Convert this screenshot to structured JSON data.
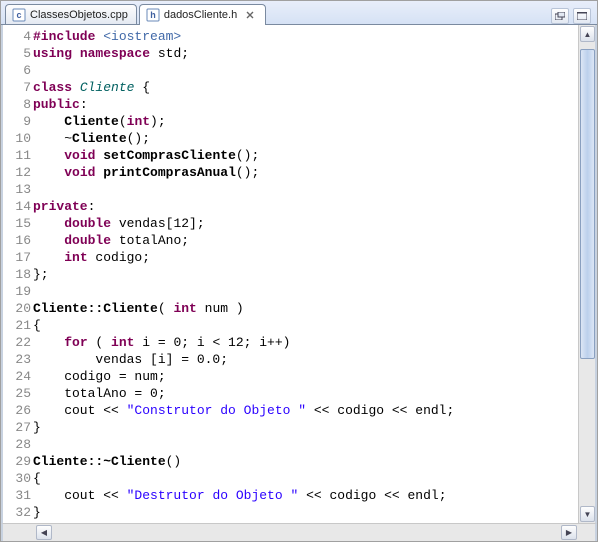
{
  "tabs": [
    {
      "icon": "c-file",
      "label": "ClassesObjetos.cpp",
      "active": false
    },
    {
      "icon": "h-file",
      "label": "dadosCliente.h",
      "active": true
    }
  ],
  "toolbar": {
    "maximize_title": "Maximize",
    "restore_title": "Restore"
  },
  "code_lines": [
    {
      "n": 4,
      "tokens": [
        [
          "pp",
          "#include "
        ],
        [
          "inc",
          "<iostream>"
        ]
      ]
    },
    {
      "n": 5,
      "tokens": [
        [
          "kw",
          "using"
        ],
        [
          "",
          " "
        ],
        [
          "kw",
          "namespace"
        ],
        [
          "",
          " std;"
        ]
      ]
    },
    {
      "n": 6,
      "tokens": []
    },
    {
      "n": 7,
      "tokens": [
        [
          "kw",
          "class"
        ],
        [
          "",
          " "
        ],
        [
          "typ",
          "Cliente"
        ],
        [
          "",
          " {"
        ]
      ]
    },
    {
      "n": 8,
      "tokens": [
        [
          "kw",
          "public"
        ],
        [
          "",
          ":"
        ]
      ]
    },
    {
      "n": 9,
      "tokens": [
        [
          "",
          "    "
        ],
        [
          "mtd",
          "Cliente"
        ],
        [
          "",
          "("
        ],
        [
          "kw",
          "int"
        ],
        [
          "",
          ");"
        ]
      ]
    },
    {
      "n": 10,
      "tokens": [
        [
          "",
          "    ~"
        ],
        [
          "mtd",
          "Cliente"
        ],
        [
          "",
          "();"
        ]
      ]
    },
    {
      "n": 11,
      "tokens": [
        [
          "",
          "    "
        ],
        [
          "kw",
          "void"
        ],
        [
          "",
          " "
        ],
        [
          "mtd",
          "setComprasCliente"
        ],
        [
          "",
          "();"
        ]
      ]
    },
    {
      "n": 12,
      "tokens": [
        [
          "",
          "    "
        ],
        [
          "kw",
          "void"
        ],
        [
          "",
          " "
        ],
        [
          "mtd",
          "printComprasAnual"
        ],
        [
          "",
          "();"
        ]
      ]
    },
    {
      "n": 13,
      "tokens": []
    },
    {
      "n": 14,
      "tokens": [
        [
          "kw",
          "private"
        ],
        [
          "",
          ":"
        ]
      ]
    },
    {
      "n": 15,
      "tokens": [
        [
          "",
          "    "
        ],
        [
          "kw",
          "double"
        ],
        [
          "",
          " vendas[12];"
        ]
      ]
    },
    {
      "n": 16,
      "tokens": [
        [
          "",
          "    "
        ],
        [
          "kw",
          "double"
        ],
        [
          "",
          " totalAno;"
        ]
      ]
    },
    {
      "n": 17,
      "tokens": [
        [
          "",
          "    "
        ],
        [
          "kw",
          "int"
        ],
        [
          "",
          " codigo;"
        ]
      ]
    },
    {
      "n": 18,
      "tokens": [
        [
          "",
          "};"
        ]
      ]
    },
    {
      "n": 19,
      "tokens": []
    },
    {
      "n": 20,
      "tokens": [
        [
          "mtd",
          "Cliente::Cliente"
        ],
        [
          "",
          "( "
        ],
        [
          "kw",
          "int"
        ],
        [
          "",
          " num )"
        ]
      ]
    },
    {
      "n": 21,
      "tokens": [
        [
          "",
          "{"
        ]
      ]
    },
    {
      "n": 22,
      "tokens": [
        [
          "",
          "    "
        ],
        [
          "kw",
          "for"
        ],
        [
          "",
          " ( "
        ],
        [
          "kw",
          "int"
        ],
        [
          "",
          " i = 0; i < 12; i++)"
        ]
      ]
    },
    {
      "n": 23,
      "tokens": [
        [
          "",
          "        vendas [i] = 0.0;"
        ]
      ]
    },
    {
      "n": 24,
      "tokens": [
        [
          "",
          "    codigo = num;"
        ]
      ]
    },
    {
      "n": 25,
      "tokens": [
        [
          "",
          "    totalAno = 0;"
        ]
      ]
    },
    {
      "n": 26,
      "tokens": [
        [
          "",
          "    cout << "
        ],
        [
          "str",
          "\"Construtor do Objeto \""
        ],
        [
          "",
          " << codigo << endl;"
        ]
      ]
    },
    {
      "n": 27,
      "tokens": [
        [
          "",
          "}"
        ]
      ]
    },
    {
      "n": 28,
      "tokens": []
    },
    {
      "n": 29,
      "tokens": [
        [
          "mtd",
          "Cliente::~Cliente"
        ],
        [
          "",
          "()"
        ]
      ]
    },
    {
      "n": 30,
      "tokens": [
        [
          "",
          "{"
        ]
      ]
    },
    {
      "n": 31,
      "tokens": [
        [
          "",
          "    cout << "
        ],
        [
          "str",
          "\"Destrutor do Objeto \""
        ],
        [
          "",
          " << codigo << endl;"
        ]
      ]
    },
    {
      "n": 32,
      "tokens": [
        [
          "",
          "}"
        ]
      ]
    }
  ]
}
